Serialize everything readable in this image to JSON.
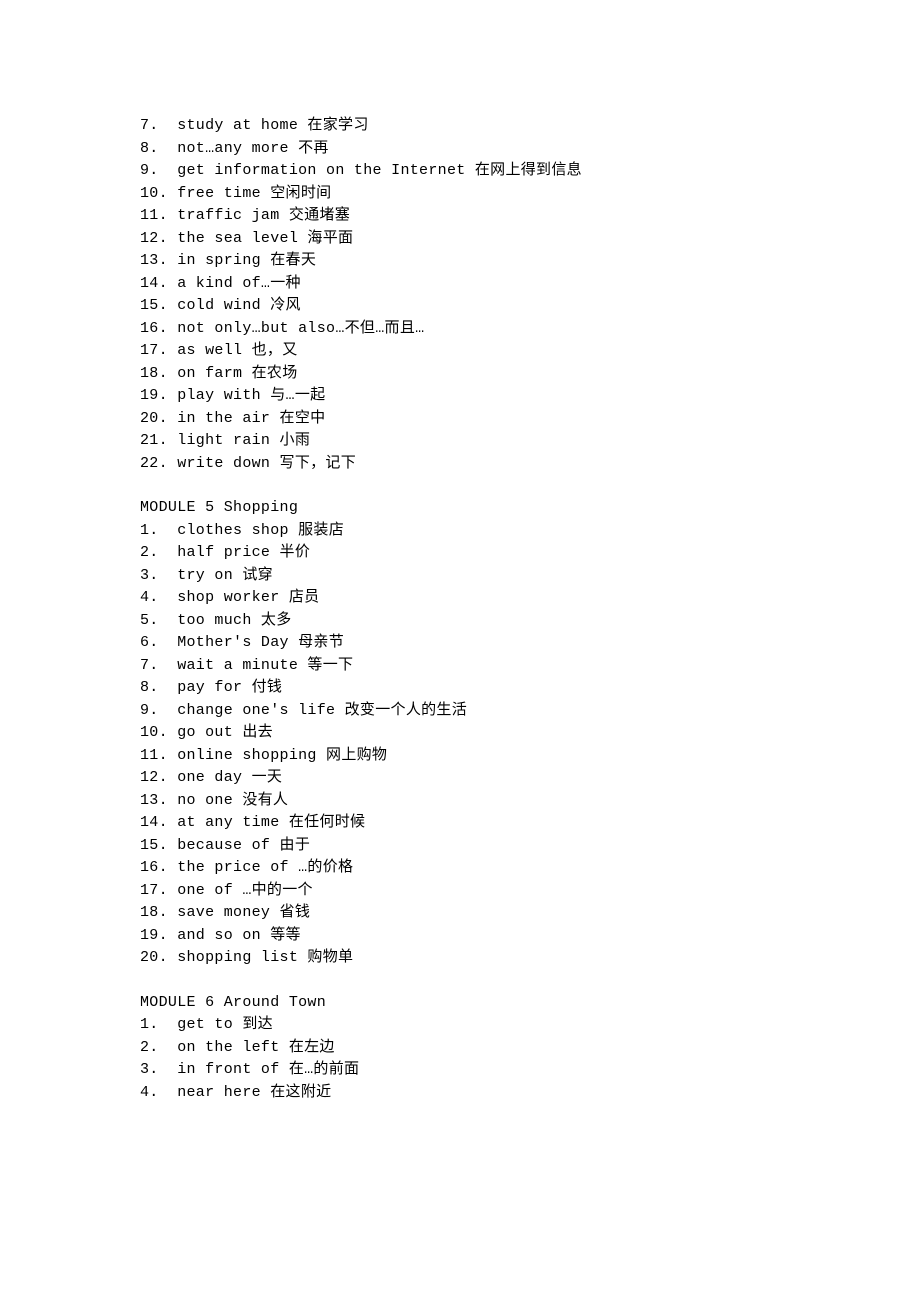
{
  "blocks": [
    {
      "title": null,
      "start": 7,
      "items": [
        "study at home 在家学习",
        "not…any more 不再",
        "get information on the Internet 在网上得到信息",
        "free time 空闲时间",
        "traffic jam 交通堵塞",
        "the sea level 海平面",
        "in spring 在春天",
        "a kind of…一种",
        "cold wind 冷风",
        "not only…but also…不但…而且…",
        "as well 也，又",
        "on farm 在农场",
        "play with 与…一起",
        "in the air 在空中",
        "light rain 小雨",
        "write down 写下，记下"
      ]
    },
    {
      "title": "MODULE 5 Shopping",
      "start": 1,
      "items": [
        "clothes shop 服装店",
        "half price 半价",
        "try on 试穿",
        "shop worker 店员",
        "too much 太多",
        "Mother's Day 母亲节",
        "wait a minute 等一下",
        "pay for 付钱",
        "change one's life 改变一个人的生活",
        "go out 出去",
        "online shopping 网上购物",
        "one day 一天",
        "no one 没有人",
        "at any time 在任何时候",
        "because of 由于",
        "the price of …的价格",
        "one of …中的一个",
        "save money 省钱",
        "and so on 等等",
        "shopping list 购物单"
      ]
    },
    {
      "title": "MODULE 6 Around Town",
      "start": 1,
      "items": [
        "get to 到达",
        "on the left 在左边",
        "in front of 在…的前面",
        "near here 在这附近"
      ]
    }
  ]
}
